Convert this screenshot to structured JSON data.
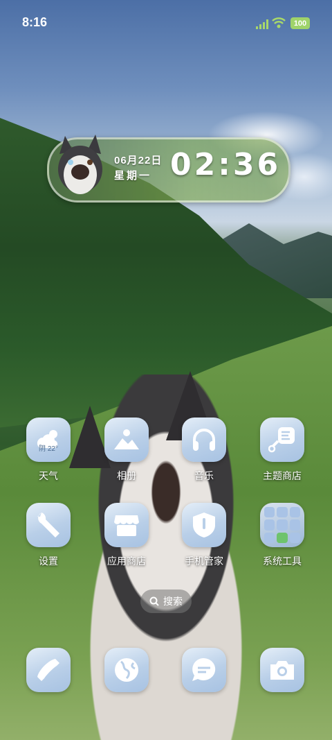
{
  "status": {
    "time": "8:16",
    "battery": "100"
  },
  "widget": {
    "date": "06月22日",
    "weekday": "星期一",
    "time": "02:36"
  },
  "weather_badge": "阴 22°",
  "apps": [
    {
      "label": "天气",
      "icon": "weather-icon"
    },
    {
      "label": "相册",
      "icon": "gallery-icon"
    },
    {
      "label": "音乐",
      "icon": "headphones-icon"
    },
    {
      "label": "主题商店",
      "icon": "theme-store-icon"
    },
    {
      "label": "设置",
      "icon": "wrench-icon"
    },
    {
      "label": "应用商店",
      "icon": "app-store-icon"
    },
    {
      "label": "手机管家",
      "icon": "shield-icon"
    },
    {
      "label": "系统工具",
      "icon": "folder-icon"
    }
  ],
  "search_label": "搜索",
  "dock": [
    {
      "icon": "phone-icon"
    },
    {
      "icon": "browser-icon"
    },
    {
      "icon": "messages-icon"
    },
    {
      "icon": "camera-icon"
    }
  ],
  "colors": {
    "icon_tile": "#b9cfe8",
    "glyph": "#ffffff",
    "battery": "#9fd36a"
  }
}
